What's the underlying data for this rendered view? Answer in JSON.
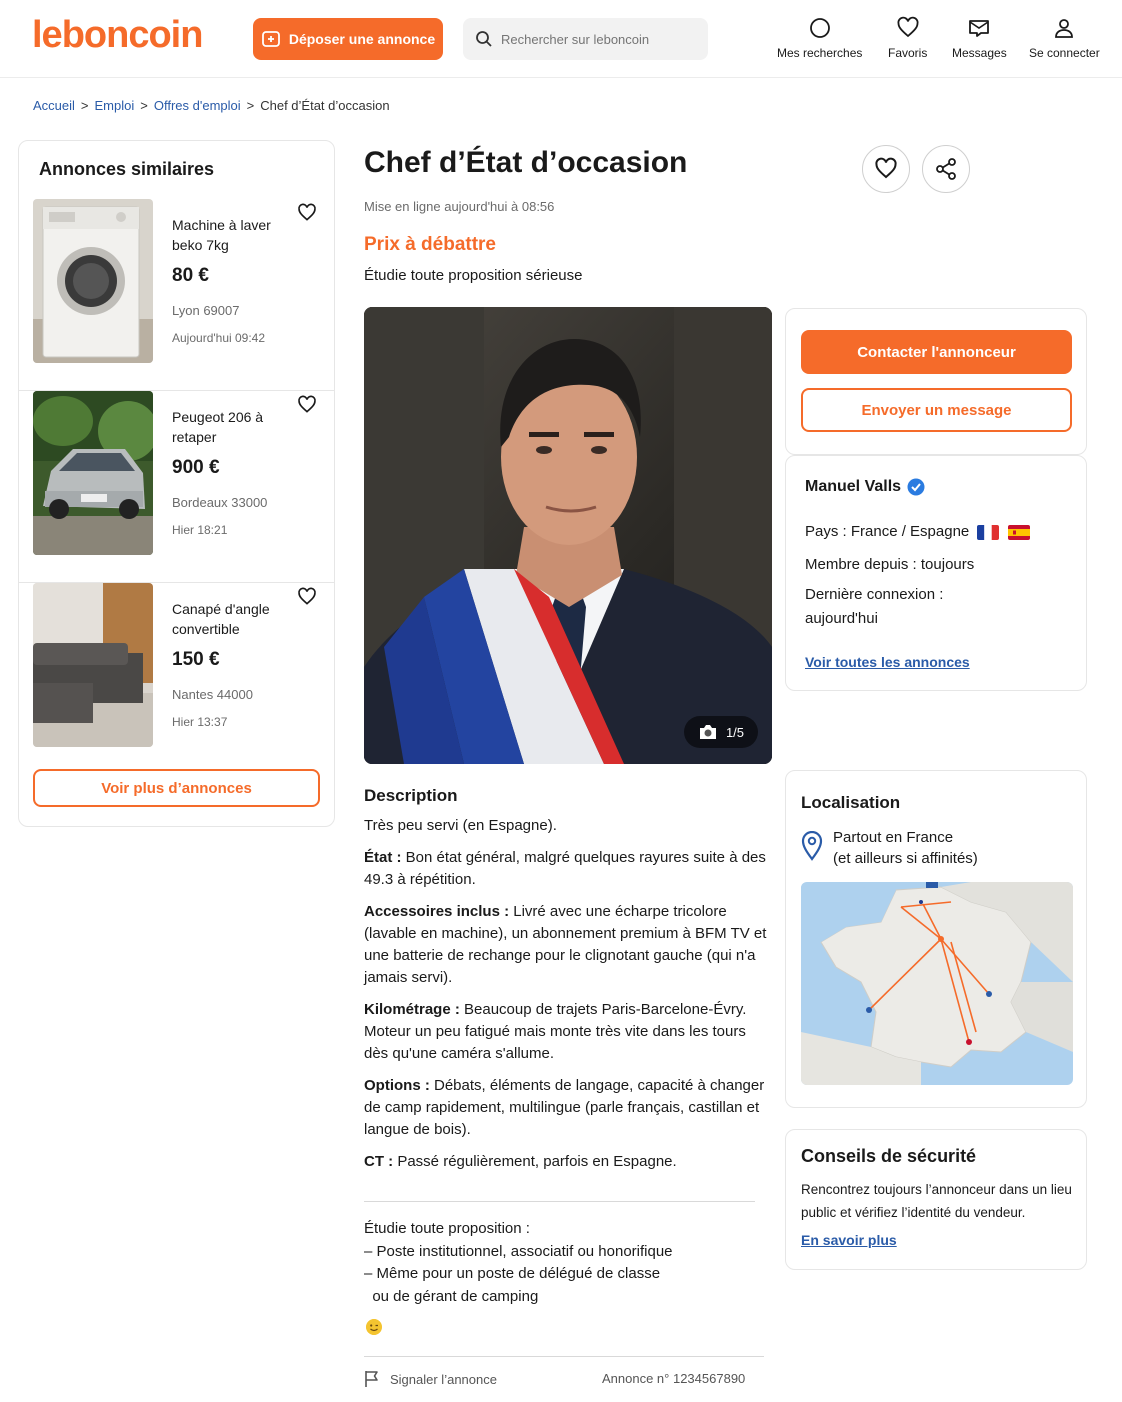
{
  "header": {
    "logo": "leboncoin",
    "post_button": "Déposer une annonce",
    "search_placeholder": "Rechercher sur leboncoin",
    "nav": [
      {
        "label": "Mes recherches",
        "icon": "circle-icon"
      },
      {
        "label": "Favoris",
        "icon": "heart-icon"
      },
      {
        "label": "Messages",
        "icon": "message-icon"
      },
      {
        "label": "Se connecter",
        "icon": "user-icon"
      }
    ]
  },
  "breadcrumb": [
    "Accueil",
    "Emploi",
    "Offres d'emploi",
    "Chef d’État d’occasion"
  ],
  "similar": {
    "title": "Annonces similaires",
    "items": [
      {
        "title": "Machine à laver beko 7kg",
        "price": "80 €",
        "location": "Lyon 69007",
        "date": "Aujourd'hui 09:42"
      },
      {
        "title": "Peugeot 206 à retaper",
        "price": "900 €",
        "location": "Bordeaux 33000",
        "date": "Hier 18:21"
      },
      {
        "title": "Canapé d'angle convertible",
        "price": "150 €",
        "location": "Nantes 44000",
        "date": "Hier 13:37"
      }
    ],
    "more_button": "Voir plus d’annonces"
  },
  "ad": {
    "title": "Chef d’État d’occasion",
    "posted": "Mise en ligne aujourd'hui à 08:56",
    "price": "Prix à débattre",
    "price_sub": "Étudie toute proposition sérieuse",
    "photo_count": "1/5",
    "description_title": "Description",
    "description_intro": "Très peu servi (en Espagne).",
    "details": [
      {
        "label": "État :",
        "text": " Bon état général, malgré quelques rayures suite à des 49.3 à répétition."
      },
      {
        "label": "Accessoires inclus :",
        "text": " Livré avec une écharpe tricolore (lavable en machine), un abonnement premium à BFM TV et une batterie de rechange pour le clignotant gauche (qui n'a jamais servi)."
      },
      {
        "label": "Kilométrage :",
        "text": " Beaucoup de trajets Paris-Barcelone-Évry. Moteur un peu fatigué mais monte très vite dans les tours dès qu'une caméra s'allume."
      },
      {
        "label": "Options :",
        "text": " Débats, éléments de langage, capacité à changer de camp rapidement, multilingue (parle français, castillan et langue de bois)."
      },
      {
        "label": "CT :",
        "text": " Passé régulièrement, parfois en Espagne."
      }
    ],
    "proposals": [
      "Étudie toute proposition :",
      "– Poste institutionnel, associatif ou honorifique",
      "– Même pour un poste de délégué de classe",
      "  ou de gérant de camping"
    ],
    "report": "Signaler l’annonce",
    "ad_number": "Annonce n° 1234567890"
  },
  "contact": {
    "contact_button": "Contacter l'annonceur",
    "message_button": "Envoyer un message"
  },
  "seller": {
    "name": "Manuel Valls",
    "country": "Pays : France / Espagne",
    "member_since": "Membre depuis : toujours",
    "last_login_1": "Dernière connexion :",
    "last_login_2": "aujourd'hui",
    "all_ads_link": "Voir toutes les annonces"
  },
  "location": {
    "title": "Localisation",
    "line1": "Partout en France",
    "line2": "(et ailleurs si affinités)"
  },
  "safety": {
    "title": "Conseils de sécurité",
    "text": "Rencontrez toujours l’annonceur dans un lieu public et vérifiez l’identité du vendeur.",
    "link": "En savoir plus"
  },
  "colors": {
    "brand": "#f56b2a",
    "link": "#2a5ba8"
  }
}
